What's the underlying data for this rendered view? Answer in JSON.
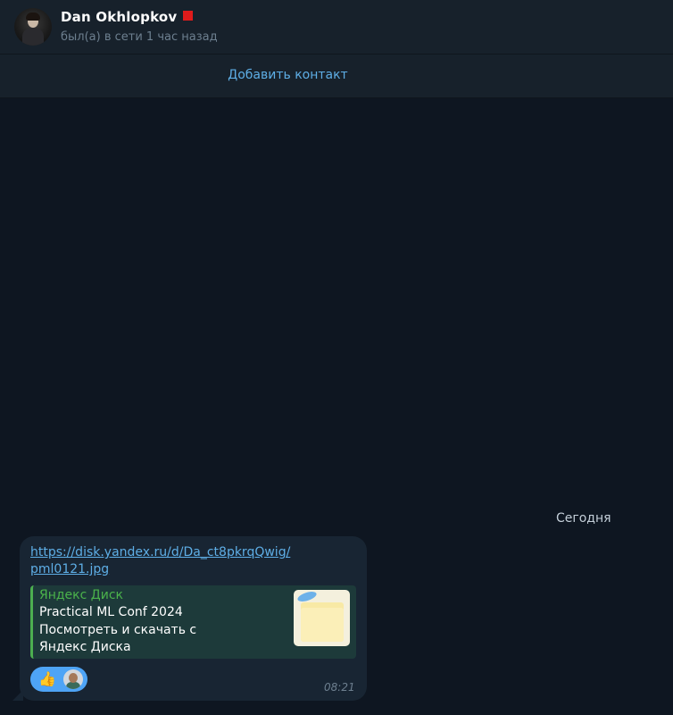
{
  "header": {
    "name": "Dan Okhlopkov",
    "flag_color": "#e01b1b",
    "status": "был(а) в сети 1 час назад"
  },
  "add_contact": {
    "label": "Добавить контакт"
  },
  "chat": {
    "date_label": "Сегодня",
    "message": {
      "link_line1": "https://disk.yandex.ru/d/Da_ct8pkrqQwig/",
      "link_line2": "pml0121.jpg",
      "preview": {
        "site_name": "Яндекс Диск",
        "title": "Practical ML Conf 2024",
        "description": "Посмотреть и скачать с Яндекс Диска"
      },
      "reaction_emoji": "👍",
      "time": "08:21"
    }
  },
  "colors": {
    "background": "#0e1621",
    "header": "#17212b",
    "bubble": "#182533",
    "accent": "#5eaee6",
    "preview_bar": "#4caf50"
  }
}
